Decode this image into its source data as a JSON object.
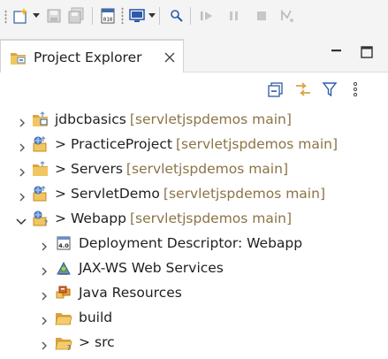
{
  "toolbar": {
    "items": [
      "new-wizard",
      "save",
      "save-all",
      "binary-file",
      "console",
      "search",
      "resume",
      "suspend",
      "terminate",
      "step"
    ]
  },
  "view": {
    "tab_title": "Project Explorer",
    "close_glyph": "×"
  },
  "tree": {
    "items": [
      {
        "label": "jdbcbasics",
        "dirty": "",
        "decoration": "[servletjspdemos main]",
        "expanded": false,
        "icon": "project-folder-icon"
      },
      {
        "label": "PracticeProject",
        "dirty": ">",
        "decoration": "[servletjspdemos main]",
        "expanded": false,
        "icon": "web-project-icon"
      },
      {
        "label": "Servers",
        "dirty": ">",
        "decoration": "[servletjspdemos main]",
        "expanded": false,
        "icon": "project-folder-icon"
      },
      {
        "label": "ServletDemo",
        "dirty": ">",
        "decoration": "[servletjspdemos main]",
        "expanded": false,
        "icon": "web-project-icon"
      },
      {
        "label": "Webapp",
        "dirty": ">",
        "decoration": "[servletjspdemos main]",
        "expanded": true,
        "icon": "web-project-icon"
      },
      {
        "label": "Deployment Descriptor: Webapp",
        "dirty": "",
        "decoration": "",
        "expanded": false,
        "icon": "deployment-descriptor-icon"
      },
      {
        "label": "JAX-WS Web Services",
        "dirty": "",
        "decoration": "",
        "expanded": false,
        "icon": "web-services-icon"
      },
      {
        "label": "Java Resources",
        "dirty": "",
        "decoration": "",
        "expanded": false,
        "icon": "java-resources-icon"
      },
      {
        "label": "build",
        "dirty": "",
        "decoration": "",
        "expanded": false,
        "icon": "folder-icon"
      },
      {
        "label": "src",
        "dirty": ">",
        "decoration": "",
        "expanded": false,
        "icon": "source-folder-icon"
      }
    ]
  },
  "colors": {
    "decoration": "#8a7445",
    "background": "#ffffff",
    "chrome": "#f4f4f4"
  }
}
